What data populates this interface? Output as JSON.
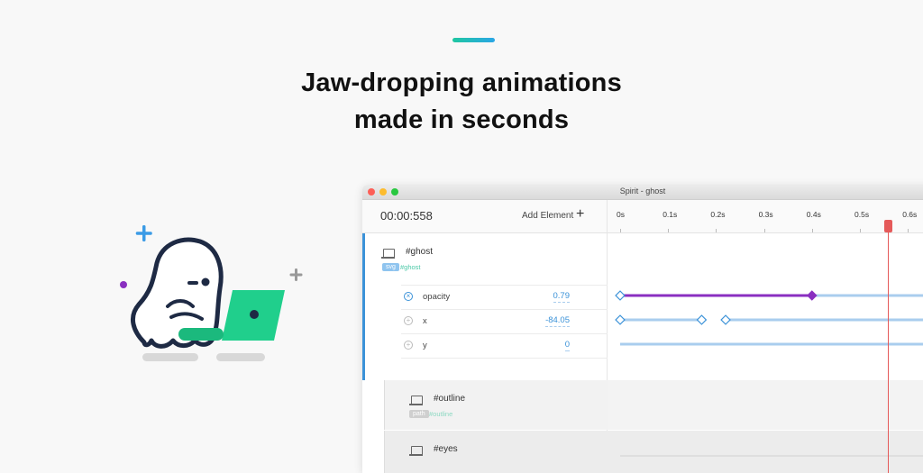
{
  "headline": {
    "line1": "Jaw-dropping animations",
    "line2": "made in seconds"
  },
  "colors": {
    "accent_start": "#1fc7a1",
    "accent_end": "#2aa6e6",
    "selection_blue": "#3b92d8",
    "keyframe_purple": "#8a2fc0",
    "track_blue": "#a9cdee",
    "playhead_red": "#e55a5a",
    "laptop_green": "#20cf8c"
  },
  "window": {
    "title": "Spirit - ghost"
  },
  "toolbar": {
    "timecode": "00:00:558",
    "add_element_label": "Add Element",
    "add_icon": "plus-icon"
  },
  "timeline": {
    "ticks": [
      "0s",
      "0.1s",
      "0.2s",
      "0.3s",
      "0.4s",
      "0.5s",
      "0.6s"
    ],
    "playhead_time_s": 0.558
  },
  "layers": {
    "ghost": {
      "name": "#ghost",
      "tag": "svg",
      "class_name": "#ghost",
      "properties": [
        {
          "name": "opacity",
          "value": "0.79",
          "icon": "close-circle-icon"
        },
        {
          "name": "x",
          "value": "-84.05",
          "icon": "add-circle-icon"
        },
        {
          "name": "y",
          "value": "0",
          "icon": "add-circle-icon"
        }
      ]
    },
    "outline": {
      "name": "#outline",
      "tag": "path",
      "class_name": "#outline"
    },
    "eyes": {
      "name": "#eyes"
    }
  }
}
